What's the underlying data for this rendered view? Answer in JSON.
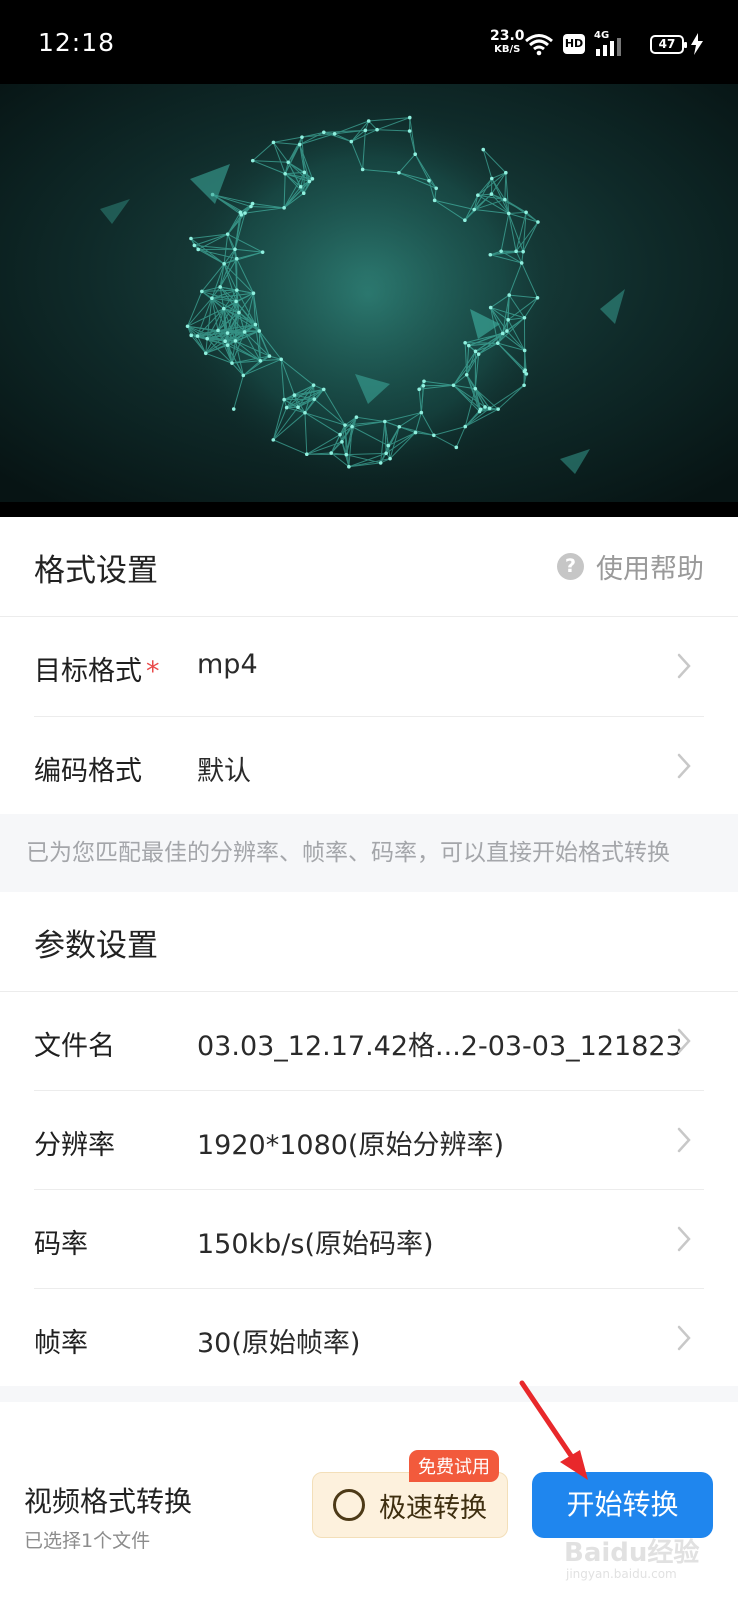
{
  "status_bar": {
    "time": "12:18",
    "net_speed": "23.0",
    "net_speed_unit": "KB/S",
    "hd_label": "HD",
    "network_label": "4G",
    "battery": "47"
  },
  "format_settings": {
    "title": "格式设置",
    "help_label": "使用帮助",
    "rows": [
      {
        "label": "目标格式",
        "required_mark": "*",
        "value": "mp4"
      },
      {
        "label": "编码格式",
        "value": "默认"
      }
    ],
    "notice": "已为您匹配最佳的分辨率、帧率、码率，可以直接开始格式转换"
  },
  "param_settings": {
    "title": "参数设置",
    "rows": [
      {
        "label": "文件名",
        "value": "03.03_12.17.42格...2-03-03_121823"
      },
      {
        "label": "分辨率",
        "value": "1920*1080(原始分辨率)"
      },
      {
        "label": "码率",
        "value": "150kb/s(原始码率)"
      },
      {
        "label": "帧率",
        "value": "30(原始帧率)"
      }
    ]
  },
  "bottom_bar": {
    "title": "视频格式转换",
    "subtitle": "已选择1个文件",
    "fast_label": "极速转换",
    "free_badge": "免费试用",
    "start_label": "开始转换"
  },
  "watermark": {
    "text": "Baidu经验",
    "url": "jingyan.baidu.com"
  },
  "colors": {
    "accent": "#1f86ee",
    "badge": "#f25a3c",
    "required": "#e94a4a",
    "annotation_arrow": "#e8282b"
  }
}
